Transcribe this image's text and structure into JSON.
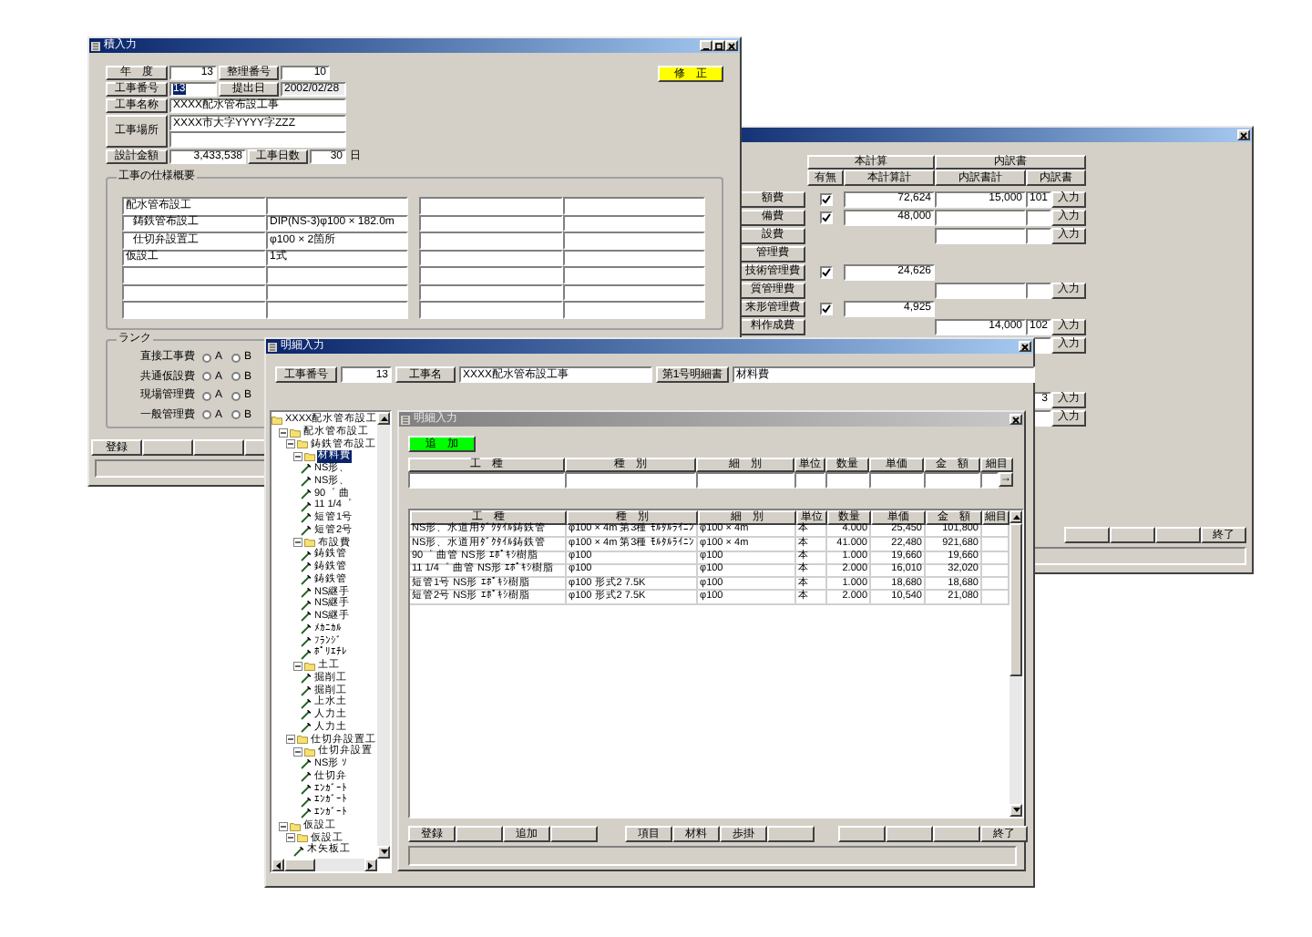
{
  "main_window": {
    "title": "積入力",
    "year": {
      "label": "年　度",
      "value": "13"
    },
    "serial": {
      "label": "整理番号",
      "value": "10"
    },
    "edit_button": "修　正",
    "work_no": {
      "label": "工事番号",
      "value": "13",
      "selected": true
    },
    "submitted": {
      "label": "提出日",
      "value": "2002/02/28"
    },
    "work_name": {
      "label": "工事名称",
      "value": "XXXX配水管布設工事"
    },
    "work_place": {
      "label": "工事場所",
      "value": "XXXX市大字YYYY字ZZZ"
    },
    "design_amount": {
      "label": "設計金額",
      "value": "3,433,538"
    },
    "work_days": {
      "label": "工事日数",
      "value": "30",
      "unit": "日"
    },
    "spec": {
      "title": "工事の仕様概要",
      "rows": [
        {
          "item": "配水管布設工",
          "children": [
            {
              "item": "鋳鉄管布設工",
              "detail": "DIP(NS-3)φ100 × 182.0m"
            },
            {
              "item": "仕切弁設置工",
              "detail": "φ100 × 2箇所"
            }
          ]
        },
        {
          "item": "仮設工",
          "detail": "1式"
        }
      ]
    },
    "rank": {
      "title": "ランク",
      "rows": [
        {
          "label": "直接工事費",
          "options": [
            {
              "label": "A",
              "selected": false
            },
            {
              "label": "B",
              "selected": false
            }
          ]
        },
        {
          "label": "共通仮設費",
          "options": [
            {
              "label": "A",
              "selected": false
            },
            {
              "label": "B",
              "selected": false
            }
          ]
        },
        {
          "label": "現場管理費",
          "options": [
            {
              "label": "A",
              "selected": false
            },
            {
              "label": "B",
              "selected": false
            }
          ]
        },
        {
          "label": "一般管理費",
          "options": [
            {
              "label": "A",
              "selected": false
            },
            {
              "label": "B",
              "selected": false
            }
          ]
        }
      ]
    },
    "buttons": [
      {
        "kind": "text",
        "label": "登録"
      },
      {
        "kind": "blank"
      },
      {
        "kind": "blank"
      },
      {
        "kind": "blank"
      }
    ]
  },
  "cost_window": {
    "header": {
      "groups": [
        "本計算",
        "内訳書"
      ],
      "columns": [
        "有無",
        "本計算計",
        "内訳書計",
        "内訳書"
      ]
    },
    "rows": [
      {
        "kind": "full",
        "label": "額費",
        "checked": true,
        "calc": "72,624",
        "subtotal": "15,000",
        "sheet": "101",
        "button": "入力"
      },
      {
        "kind": "full",
        "label": "備費",
        "checked": true,
        "calc": "48,000",
        "button": "入力"
      },
      {
        "kind": "breakdown",
        "label": "設費",
        "button": "入力"
      },
      {
        "kind": "heading",
        "label": "管理費"
      },
      {
        "kind": "calc",
        "label": "技術管理費",
        "checked": true,
        "calc": "24,626"
      },
      {
        "kind": "breakdown",
        "label": "質管理費",
        "button": "入力"
      },
      {
        "kind": "calc",
        "label": "来形管理費",
        "checked": true,
        "calc": "4,925"
      },
      {
        "kind": "breakdown",
        "label": "料作成費",
        "subtotal": "14,000",
        "sheet": "102",
        "button": "入力"
      },
      {
        "kind": "breakdown",
        "button": "入力"
      },
      {
        "kind": "spacer"
      },
      {
        "kind": "spacer"
      },
      {
        "kind": "breakdown",
        "sheet": "3",
        "button": "入力"
      },
      {
        "kind": "breakdown",
        "button": "入力"
      }
    ],
    "buttons": [
      {
        "kind": "blank"
      },
      {
        "kind": "blank"
      },
      {
        "kind": "blank"
      },
      {
        "kind": "text",
        "label": "終了"
      }
    ]
  },
  "detail_window": {
    "title": "明細入力",
    "work_no": {
      "label": "工事番号",
      "value": "13"
    },
    "work_name": {
      "label": "工事名",
      "value": "XXXX配水管布設工事"
    },
    "sheet": {
      "label": "第1号明細書",
      "value": "材料費"
    },
    "tree": [
      {
        "label": "XXXX配水管布設工",
        "selected": false,
        "children": [
          {
            "label": "配水管布設工",
            "expanded": true,
            "selected": false,
            "children": [
              {
                "label": "鋳鉄管布設工",
                "expanded": true,
                "selected": false,
                "children": [
                  {
                    "label": "材料費",
                    "expanded": true,
                    "selected": true,
                    "children": [
                      {
                        "label": "NS形、",
                        "selected": false
                      },
                      {
                        "label": "NS形、",
                        "selected": false
                      },
                      {
                        "label": "90゜ 曲",
                        "selected": false
                      },
                      {
                        "label": "11 1/4゜",
                        "selected": false
                      },
                      {
                        "label": "短管1号",
                        "selected": false
                      },
                      {
                        "label": "短管2号",
                        "selected": false
                      }
                    ]
                  },
                  {
                    "label": "布設費",
                    "expanded": true,
                    "selected": false,
                    "children": [
                      {
                        "label": "鋳鉄管",
                        "selected": false
                      },
                      {
                        "label": "鋳鉄管",
                        "selected": false
                      },
                      {
                        "label": "鋳鉄管",
                        "selected": false
                      },
                      {
                        "label": "NS継手",
                        "selected": false
                      },
                      {
                        "label": "NS継手",
                        "selected": false
                      },
                      {
                        "label": "NS継手",
                        "selected": false
                      },
                      {
                        "label": "ﾒｶﾆｶﾙ",
                        "selected": false
                      },
                      {
                        "label": "ﾌﾗﾝｼﾞ",
                        "selected": false
                      },
                      {
                        "label": "ﾎﾟﾘｴﾁﾚ",
                        "selected": false
                      }
                    ]
                  },
                  {
                    "label": "土工",
                    "expanded": true,
                    "selected": false,
                    "children": [
                      {
                        "label": "掘削工",
                        "selected": false
                      },
                      {
                        "label": "掘削工",
                        "selected": false
                      },
                      {
                        "label": "上水土",
                        "selected": false
                      },
                      {
                        "label": "人力土",
                        "selected": false
                      },
                      {
                        "label": "人力土",
                        "selected": false
                      }
                    ]
                  }
                ]
              },
              {
                "label": "仕切弁設置工",
                "expanded": true,
                "selected": false,
                "children": [
                  {
                    "label": "仕切弁設置",
                    "expanded": true,
                    "selected": false,
                    "children": [
                      {
                        "label": "NS形 ｿ",
                        "selected": false
                      },
                      {
                        "label": "仕切弁",
                        "selected": false
                      },
                      {
                        "label": "ｴﾝｶﾞｰﾄ",
                        "selected": false
                      },
                      {
                        "label": "ｴﾝｶﾞｰﾄ",
                        "selected": false
                      },
                      {
                        "label": "ｴﾝｶﾞｰﾄ",
                        "selected": false
                      }
                    ]
                  }
                ]
              }
            ]
          },
          {
            "label": "仮設工",
            "expanded": true,
            "selected": false,
            "children": [
              {
                "label": "仮設工",
                "expanded": true,
                "selected": false,
                "children": [
                  {
                    "label": "木矢板工",
                    "selected": false
                  }
                ]
              }
            ]
          }
        ]
      }
    ]
  },
  "inner_window": {
    "title": "明細入力",
    "add_button": "追　加",
    "entry_columns": [
      "工　種",
      "種　別",
      "細　別",
      "単位",
      "数量",
      "単価",
      "金　額",
      "細目"
    ],
    "entry_button": "→",
    "list_columns": [
      "工　種",
      "種　別",
      "細　別",
      "単位",
      "数量",
      "単価",
      "金　額",
      "細目"
    ],
    "rows": [
      [
        "NS形、水道用ﾀﾞｸﾀｲﾙ鋳鉄管",
        "φ100 × 4m 第3種 ﾓﾙﾀﾙﾗｲﾆﾝ",
        "φ100 × 4m",
        "本",
        "4.000",
        "25,450",
        "101,800"
      ],
      [
        "NS形、水道用ﾀﾞｸﾀｲﾙ鋳鉄管",
        "φ100 × 4m 第3種 ﾓﾙﾀﾙﾗｲﾆﾝ",
        "φ100 × 4m",
        "本",
        "41.000",
        "22,480",
        "921,680"
      ],
      [
        "90゜ 曲管 NS形 ｴﾎﾟｷｼ樹脂",
        "φ100",
        "φ100",
        "本",
        "1.000",
        "19,660",
        "19,660"
      ],
      [
        "11 1/4゜ 曲管 NS形 ｴﾎﾟｷｼ樹脂",
        "φ100",
        "φ100",
        "本",
        "2.000",
        "16,010",
        "32,020"
      ],
      [
        "短管1号 NS形 ｴﾎﾟｷｼ樹脂",
        "φ100 形式2 7.5K",
        "φ100",
        "本",
        "1.000",
        "18,680",
        "18,680"
      ],
      [
        "短管2号 NS形 ｴﾎﾟｷｼ樹脂",
        "φ100 形式2 7.5K",
        "φ100",
        "本",
        "2.000",
        "10,540",
        "21,080"
      ]
    ],
    "buttons": [
      [
        {
          "kind": "text",
          "label": "登録"
        },
        {
          "kind": "blank"
        },
        {
          "kind": "text",
          "label": "追加"
        },
        {
          "kind": "blank"
        }
      ],
      [
        {
          "kind": "text",
          "label": "項目"
        },
        {
          "kind": "text",
          "label": "材料"
        },
        {
          "kind": "text",
          "label": "歩掛"
        },
        {
          "kind": "blank"
        }
      ],
      [
        {
          "kind": "blank"
        },
        {
          "kind": "blank"
        },
        {
          "kind": "blank"
        },
        {
          "kind": "text",
          "label": "終了"
        }
      ]
    ]
  }
}
